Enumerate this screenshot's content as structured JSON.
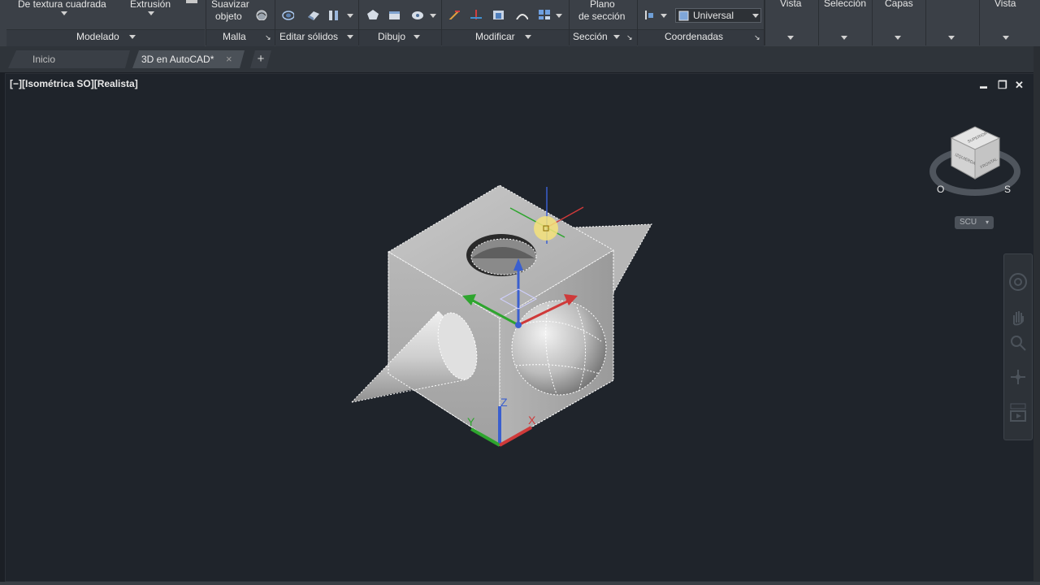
{
  "ribbon": {
    "modelado_btn1": "De textura cuadrada",
    "modelado_btn2": "Extrusión",
    "malla_btn1": "Suavizar",
    "malla_btn1b": "objeto",
    "seccion_btn1": "Plano",
    "seccion_btn1b": "de sección",
    "coord_combo_value": "Universal",
    "vista_label": "Vista",
    "seleccion_label": "Selección",
    "capas_label": "Capas",
    "vista2_label": "Vista",
    "panels": {
      "modelado": "Modelado",
      "malla": "Malla",
      "editar_solidos": "Editar sólidos",
      "dibujo": "Dibujo",
      "modificar": "Modificar",
      "seccion": "Sección",
      "coordenadas": "Coordenadas"
    }
  },
  "tabs": {
    "home": "Inicio",
    "doc": "3D en AutoCAD*",
    "close_glyph": "×",
    "plus_glyph": "+"
  },
  "viewport": {
    "label": "[−][Isométrica SO][Realista]",
    "min_glyph": "▬",
    "restore_glyph": "❐",
    "close_glyph": "✕"
  },
  "viewcube": {
    "top_face": "SUPERIOR",
    "left_face": "IZQUIERDA",
    "right_face": "FRONTAL",
    "compass_label": "O",
    "compass_label2": "S"
  },
  "ucs_menu": "SCU",
  "gizmo": {
    "x_label": "X",
    "y_label": "Y",
    "z_label": "Z"
  }
}
